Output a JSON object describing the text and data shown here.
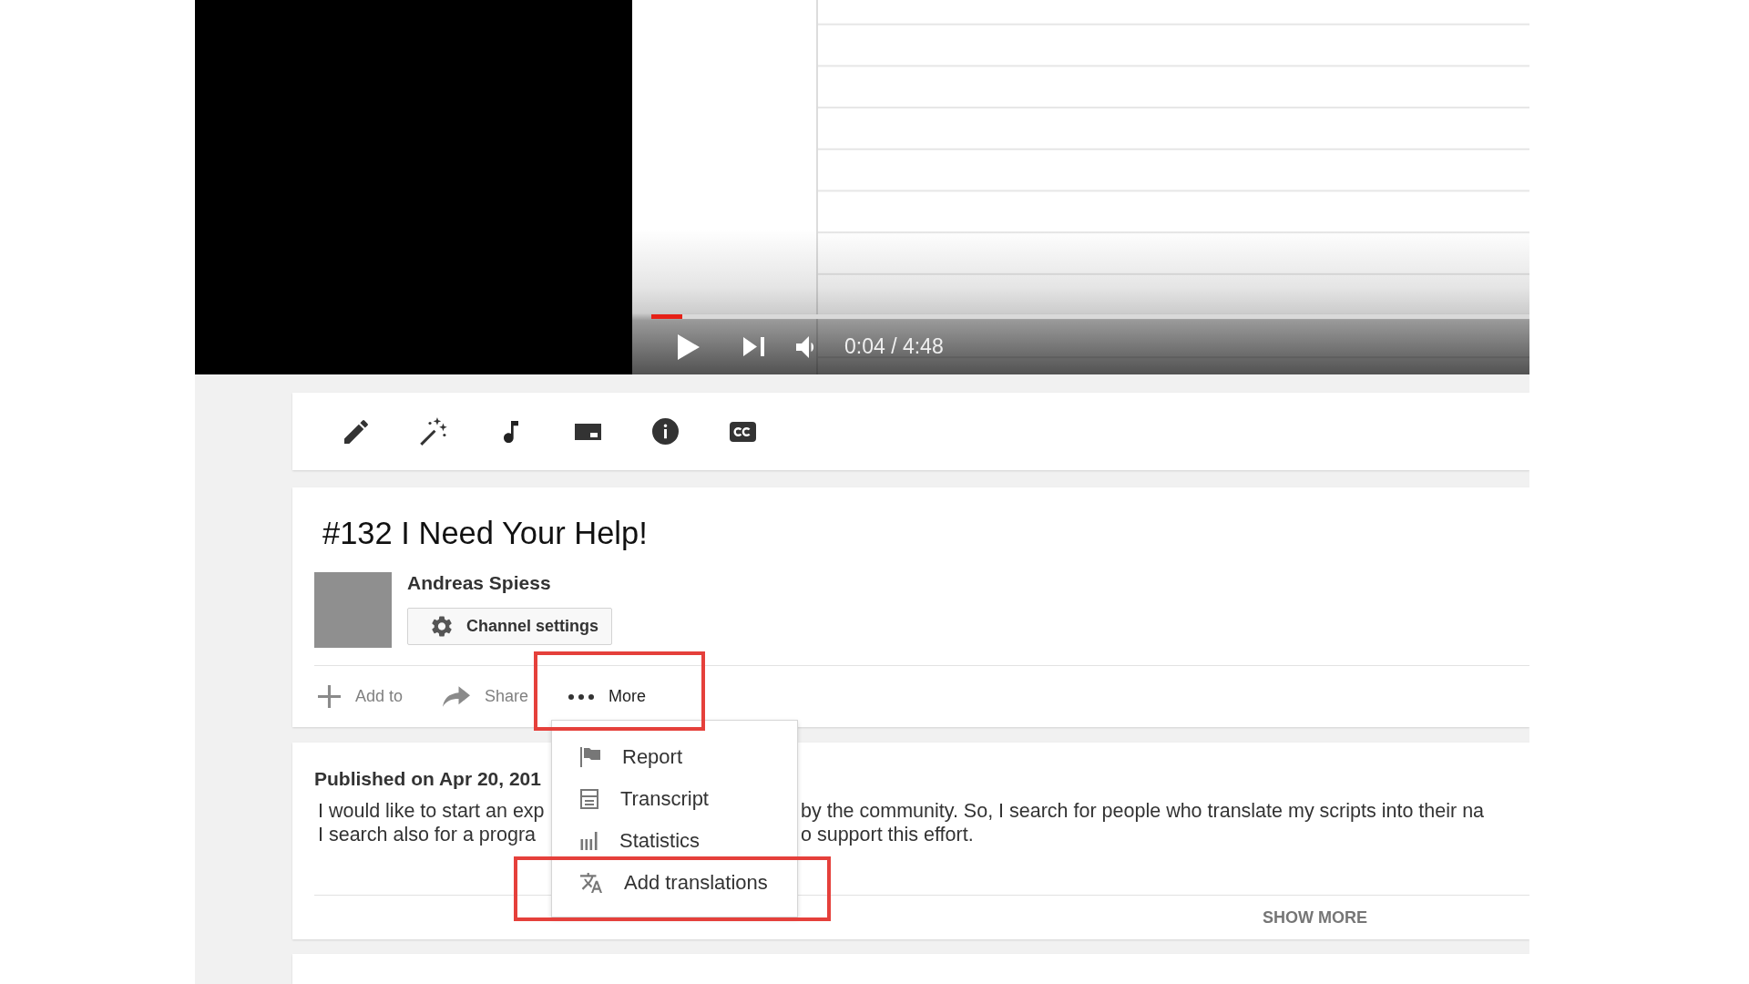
{
  "player": {
    "progress": {
      "level": 0.035
    },
    "time": "0:04 / 4:48"
  },
  "video": {
    "title": "#132 I Need Your Help!",
    "channel": {
      "name": "Andreas Spiess",
      "settings_button": "Channel settings"
    },
    "actions": [
      {
        "kind": "add",
        "label": "Add to",
        "expanded": false
      },
      {
        "kind": "share",
        "label": "Share",
        "expanded": false
      },
      {
        "kind": "more",
        "label": "More",
        "expanded": true
      }
    ]
  },
  "more_menu": {
    "items": [
      {
        "kind": "report",
        "label": "Report"
      },
      {
        "kind": "transcript",
        "label": "Transcript"
      },
      {
        "kind": "statistics",
        "label": "Statistics"
      },
      {
        "kind": "translate",
        "label": "Add translations"
      }
    ]
  },
  "description": {
    "published": "Published on Apr 20, 201",
    "lines": [
      {
        "left": "I would like to start an exp",
        "right": "by the community. So, I search for people who translate my scripts into their na"
      },
      {
        "left": "I search also for a progra",
        "right": "o support this effort."
      }
    ],
    "show_more": "SHOW MORE"
  }
}
